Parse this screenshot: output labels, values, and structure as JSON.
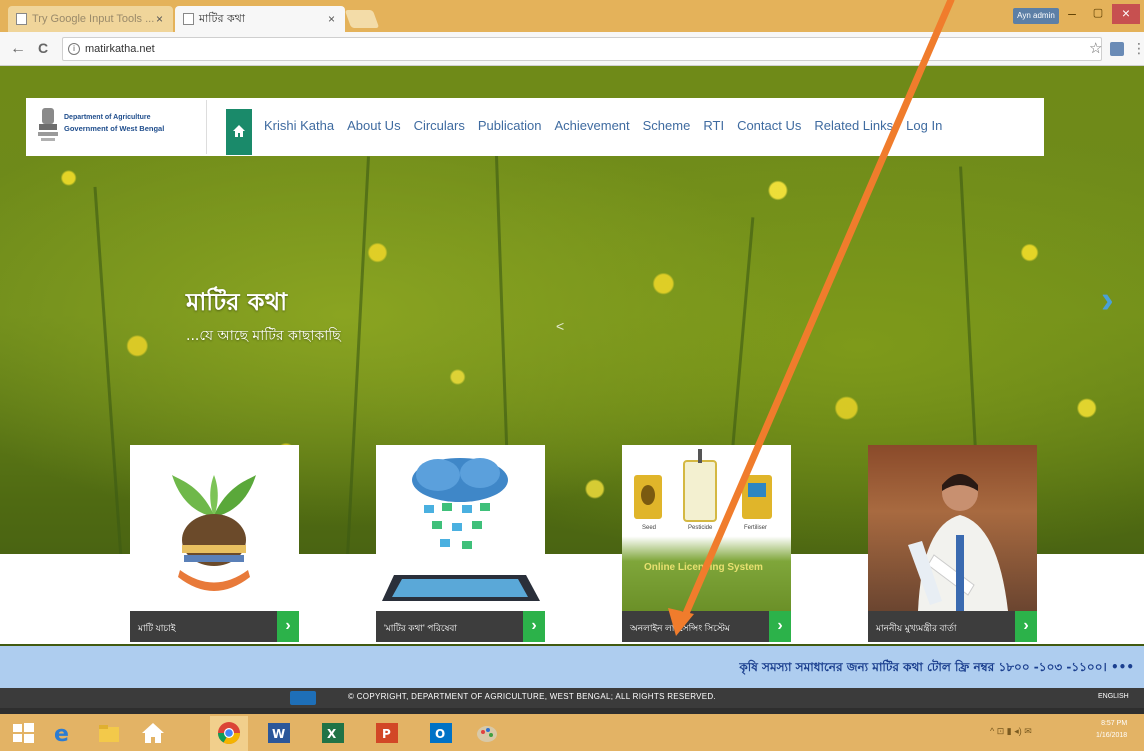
{
  "browser": {
    "tabs": [
      {
        "title": "Try Google Input Tools ..."
      },
      {
        "title": "মাটির কথা"
      }
    ],
    "tab_close": "×",
    "profile_label": "Ayn admin",
    "window_controls": {
      "minimize": "–",
      "maximize": "▢",
      "close": "×"
    },
    "nav": {
      "back": "←",
      "reload": "C",
      "info": "i"
    },
    "url": "matirkatha.net",
    "star": "☆",
    "menu_dots": "⋮"
  },
  "site": {
    "brand": {
      "line1": "Department of Agriculture",
      "line2": "Government of West Bengal"
    },
    "menu": [
      "Krishi Katha",
      "About Us",
      "Circulars",
      "Publication",
      "Achievement",
      "Scheme",
      "RTI",
      "Contact Us",
      "Related Links",
      "Log In"
    ],
    "slide": {
      "title": "মাটির কথা",
      "subtitle": "...যে আছে মাটির কাছাকাছি",
      "dot": "<",
      "next": "›"
    },
    "cards": [
      {
        "label": "মাটি যাচাই"
      },
      {
        "label": "'মাটির কথা' পরিষেবা"
      },
      {
        "label": "অনলাইন লাইসেন্সিং সিস্টেম"
      },
      {
        "label": "মাননীয় মুখ্যমন্ত্রীর বার্তা"
      }
    ],
    "card_go": "›",
    "card3_image_text": {
      "online": "Online Licensing System",
      "seed": "Seed",
      "pesticide": "Pesticide",
      "fertilizer": "Fertiliser"
    },
    "ticker": "কৃষি সমস্যা সমাধানের জন্য মাটির কথা টোল ফ্রি নম্বর ১৮০০ -১০৩ -১১০০। •••",
    "footer": "© COPYRIGHT, DEPARTMENT OF AGRICULTURE, WEST BENGAL; ALL RIGHTS RESERVED.",
    "footer_lang": "ENGLISH"
  },
  "taskbar": {
    "tray": "^ ⊡ ▮ ◂) ✉",
    "time": "8:57 PM",
    "date": "1/16/2018"
  },
  "colors": {
    "annotation_arrow": "#f07c2c",
    "menu_text": "#3f6ba0",
    "home_green": "#1a8a6a",
    "card_go_green": "#2cb24a",
    "ticker_bg": "#aecdef",
    "chrome_bg": "#e4b25a"
  }
}
